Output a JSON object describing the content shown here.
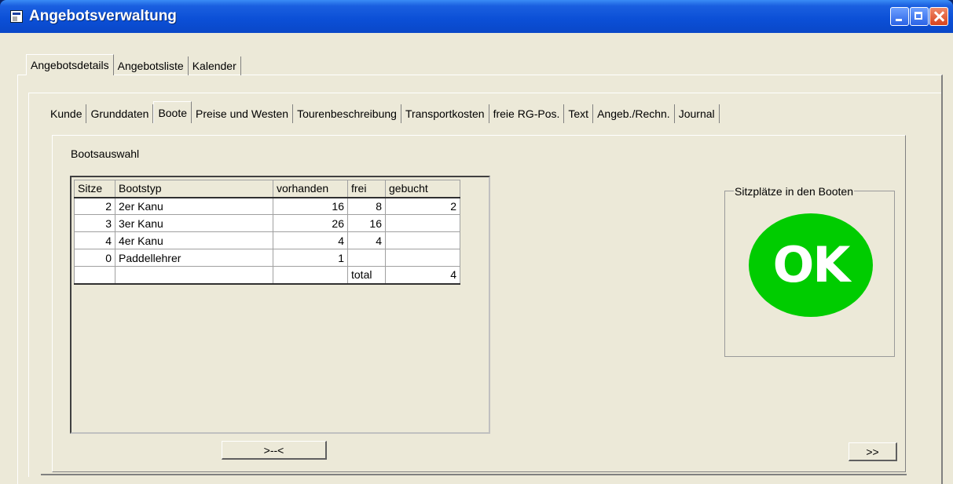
{
  "window": {
    "title": "Angebotsverwaltung"
  },
  "main_tabs": [
    {
      "label": "Angebotsdetails",
      "active": true
    },
    {
      "label": "Angebotsliste",
      "active": false
    },
    {
      "label": "Kalender",
      "active": false
    }
  ],
  "sub_tabs": [
    {
      "label": "Kunde",
      "active": false
    },
    {
      "label": "Grunddaten",
      "active": false
    },
    {
      "label": "Boote",
      "active": true
    },
    {
      "label": "Preise und Westen",
      "active": false
    },
    {
      "label": "Tourenbeschreibung",
      "active": false
    },
    {
      "label": "Transportkosten",
      "active": false
    },
    {
      "label": "freie RG-Pos.",
      "active": false
    },
    {
      "label": "Text",
      "active": false
    },
    {
      "label": "Angeb./Rechn.",
      "active": false
    },
    {
      "label": "Journal",
      "active": false
    }
  ],
  "boat_selection": {
    "label": "Bootsauswahl",
    "columns": [
      "Sitze",
      "Bootstyp",
      "vorhanden",
      "frei",
      "gebucht"
    ],
    "rows": [
      {
        "sitze": "2",
        "bootstyp": "2er Kanu",
        "vorhanden": "16",
        "frei": "8",
        "gebucht": "2"
      },
      {
        "sitze": "3",
        "bootstyp": "3er Kanu",
        "vorhanden": "26",
        "frei": "16",
        "gebucht": ""
      },
      {
        "sitze": "4",
        "bootstyp": "4er Kanu",
        "vorhanden": "4",
        "frei": "4",
        "gebucht": ""
      },
      {
        "sitze": "0",
        "bootstyp": "Paddellehrer",
        "vorhanden": "1",
        "frei": "",
        "gebucht": ""
      },
      {
        "sitze": "",
        "bootstyp": "",
        "vorhanden": "",
        "frei": "total",
        "gebucht": "4"
      }
    ],
    "shrink_button": ">--<"
  },
  "seat_status": {
    "label": "Sitzplätze in den Booten",
    "indicator": "OK",
    "indicator_color": "#00cc00"
  },
  "next_button": ">>"
}
